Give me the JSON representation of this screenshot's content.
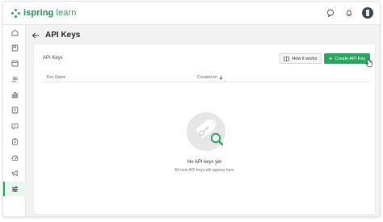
{
  "app": {
    "logo_bold": "ispring",
    "logo_light": "learn"
  },
  "topbar": {
    "icons": [
      "chat-bubble-icon",
      "bell-icon",
      "user-avatar"
    ]
  },
  "sidebar": {
    "items": [
      {
        "icon": "home-icon"
      },
      {
        "icon": "courses-icon"
      },
      {
        "icon": "calendar-icon"
      },
      {
        "icon": "users-icon"
      },
      {
        "icon": "reports-icon"
      },
      {
        "icon": "catalog-icon"
      },
      {
        "icon": "messages-icon"
      },
      {
        "icon": "tasks-icon"
      },
      {
        "icon": "gamification-icon"
      },
      {
        "icon": "announcements-icon"
      },
      {
        "icon": "settings-icon",
        "active": true
      }
    ]
  },
  "page": {
    "title": "API Keys"
  },
  "card": {
    "title": "API Keys",
    "how_it_works": "How it works",
    "create_button": "Create API Key",
    "columns": {
      "key_name": "Key Name",
      "created_on": "Created on"
    },
    "empty_title": "No API keys yet",
    "empty_subtitle": "All new API keys will appear here"
  },
  "colors": {
    "accent": "#2aa55f",
    "background": "#f2f2f2"
  }
}
